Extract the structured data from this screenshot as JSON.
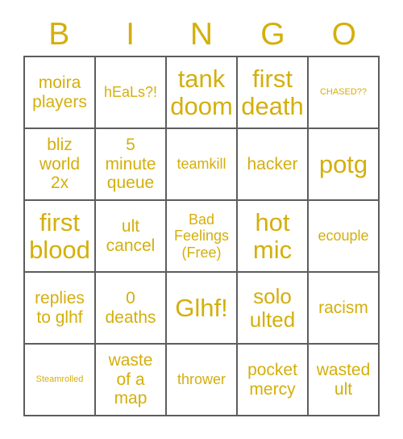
{
  "header": {
    "letters": [
      "B",
      "I",
      "N",
      "G",
      "O"
    ]
  },
  "colors": {
    "text_gold": "#d4af0c",
    "grid_border": "#5d5d5d",
    "background": "#ffffff"
  },
  "grid": {
    "rows": 5,
    "columns": 5,
    "cells": [
      {
        "text": "moira\nplayers",
        "size": "md"
      },
      {
        "text": "hEaLs?!",
        "size": "sm"
      },
      {
        "text": "tank\ndoom",
        "size": "xl"
      },
      {
        "text": "first\ndeath",
        "size": "xl"
      },
      {
        "text": "CHASED??",
        "size": "xs"
      },
      {
        "text": "bliz\nworld\n2x",
        "size": "md"
      },
      {
        "text": "5\nminute\nqueue",
        "size": "md"
      },
      {
        "text": "teamkill",
        "size": "sm"
      },
      {
        "text": "hacker",
        "size": "md"
      },
      {
        "text": "potg",
        "size": "xl"
      },
      {
        "text": "first\nblood",
        "size": "xl"
      },
      {
        "text": "ult\ncancel",
        "size": "md"
      },
      {
        "text": "Bad\nFeelings\n(Free)",
        "size": "sm"
      },
      {
        "text": "hot\nmic",
        "size": "xl"
      },
      {
        "text": "ecouple",
        "size": "sm"
      },
      {
        "text": "replies\nto glhf",
        "size": "md"
      },
      {
        "text": "0\ndeaths",
        "size": "md"
      },
      {
        "text": "Glhf!",
        "size": "xl"
      },
      {
        "text": "solo\nulted",
        "size": "lg"
      },
      {
        "text": "racism",
        "size": "md"
      },
      {
        "text": "Steamrolled",
        "size": "xs"
      },
      {
        "text": "waste\nof a\nmap",
        "size": "md"
      },
      {
        "text": "thrower",
        "size": "sm"
      },
      {
        "text": "pocket\nmercy",
        "size": "md"
      },
      {
        "text": "wasted\nult",
        "size": "md"
      }
    ]
  }
}
